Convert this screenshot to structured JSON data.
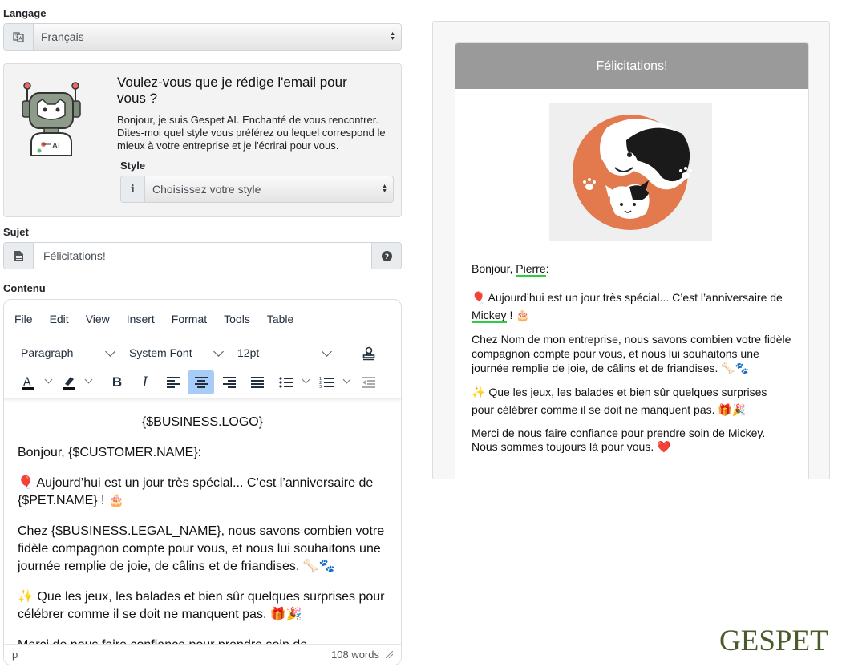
{
  "language": {
    "label": "Langage",
    "value": "Français"
  },
  "ai": {
    "title": "Voulez-vous que je rédige l'email pour vous ?",
    "description": "Bonjour, je suis Gespet AI. Enchanté de vous rencontrer. Dites-moi quel style vous préférez ou lequel correspond le mieux à votre entreprise et je l'écrirai pour vous.",
    "style_label": "Style",
    "style_value": "Choisissez votre style",
    "info_icon": "i"
  },
  "subject": {
    "label": "Sujet",
    "value": "Félicitations!"
  },
  "content": {
    "label": "Contenu",
    "menu": [
      "File",
      "Edit",
      "View",
      "Insert",
      "Format",
      "Tools",
      "Table"
    ],
    "block_format": "Paragraph",
    "font_family": "System Font",
    "font_size": "12pt",
    "body": {
      "logo": "{$BUSINESS.LOGO}",
      "greeting": "Bonjour, {$CUSTOMER.NAME}:",
      "p1": "🎈 Aujourd’hui est un jour très spécial... C’est l’anniversaire de {$PET.NAME} ! 🎂",
      "p2": "Chez {$BUSINESS.LEGAL_NAME}, nous savons combien votre fidèle compagnon compte pour vous, et nous lui souhaitons une journée remplie de joie, de câlins et de friandises. 🦴🐾",
      "p3": "✨ Que les jeux, les balades et bien sûr quelques surprises pour célébrer comme il se doit ne manquent pas. 🎁🎉",
      "p4": "Merci de nous faire confiance pour prendre soin de"
    },
    "status_path": "p",
    "word_count": "108 words"
  },
  "preview": {
    "header": "Félicitations!",
    "greeting_prefix": "Bonjour, ",
    "customer_name": "Pierre",
    "greeting_suffix": ":",
    "p1_prefix": "🎈 Aujourd’hui est un jour très spécial... C’est l’anniversaire de",
    "pet_name": "Mickey",
    "p1_suffix": " ! 🎂",
    "p2": "Chez Nom de mon entreprise, nous savons combien votre fidèle compagnon compte pour vous, et nous lui souhaitons une journée remplie de joie, de câlins et de friandises. 🦴🐾",
    "p3": "✨ Que les jeux, les balades et bien sûr quelques surprises pour célébrer comme il se doit ne manquent pas. 🎁🎉",
    "p4": "Merci de nous faire confiance pour prendre soin de Mickey. Nous sommes toujours là pour vous. ❤️"
  },
  "brand": {
    "logo_text": "GESPET"
  },
  "colors": {
    "accent": "#a6ccf7",
    "preview_header": "#9a9a9a",
    "underline": "#2ecc40",
    "brand": "#4b5a2a",
    "logo_orange": "#e27a4e"
  }
}
